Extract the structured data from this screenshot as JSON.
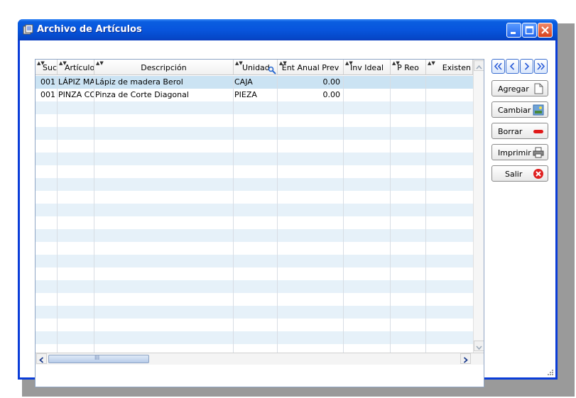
{
  "window": {
    "title": "Archivo de Artículos"
  },
  "grid": {
    "columns": [
      {
        "label": "Suc"
      },
      {
        "label": "Artículo"
      },
      {
        "label": "Descripción"
      },
      {
        "label": "Unidad"
      },
      {
        "label": "Ent Anual Prev"
      },
      {
        "label": "Inv Ideal"
      },
      {
        "label": "P Reo"
      },
      {
        "label": "Existen"
      }
    ],
    "rows": [
      {
        "suc": "001",
        "articulo": "LÁPIZ MAI",
        "descripcion": "Lápiz de madera Berol",
        "unidad": "CAJA",
        "ent_anual": "0.00"
      },
      {
        "suc": "001",
        "articulo": "PINZA COI",
        "descripcion": "Pinza de Corte Diagonal",
        "unidad": "PIEZA",
        "ent_anual": "0.00"
      }
    ],
    "hscroll_grip": "III"
  },
  "actions": {
    "agregar": "Agregar",
    "cambiar": "Cambiar",
    "borrar": "Borrar",
    "imprimir": "Imprimir",
    "salir": "Salir"
  },
  "colors": {
    "titlebar": "#0855dd",
    "selected_row": "#cbe3f3",
    "alt_row": "#e6f1f9",
    "close_red": "#d8401c"
  }
}
